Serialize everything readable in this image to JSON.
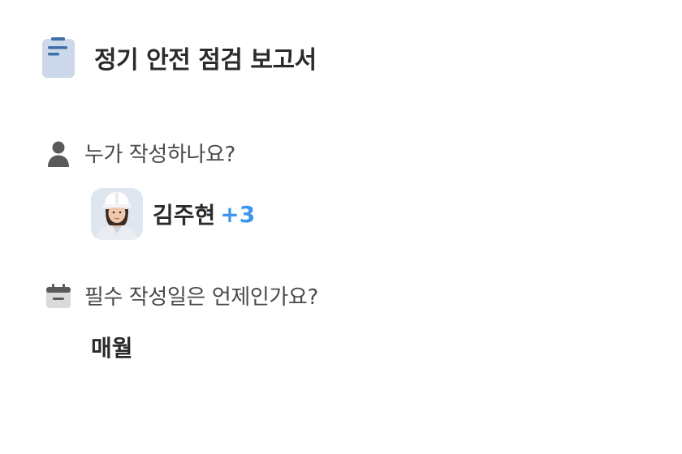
{
  "report": {
    "title": "정기 안전 점검 보고서",
    "icon": "document-icon"
  },
  "writers_section": {
    "icon": "person-icon",
    "question": "누가 작성하나요?",
    "writer_name": "김주현",
    "extra_count": "+3",
    "avatar": "avatar-worker-hardhat"
  },
  "due_section": {
    "icon": "calendar-icon",
    "question": "필수 작성일은 언제인가요?",
    "answer": "매월"
  },
  "colors": {
    "accent": "#3c95f0",
    "text_primary": "#2b2b2b",
    "text_secondary": "#4a4a4a",
    "icon_gray": "#5a5a5a",
    "doc_icon_bg": "#cdd9ea",
    "doc_icon_lines": "#3f6fa8"
  }
}
